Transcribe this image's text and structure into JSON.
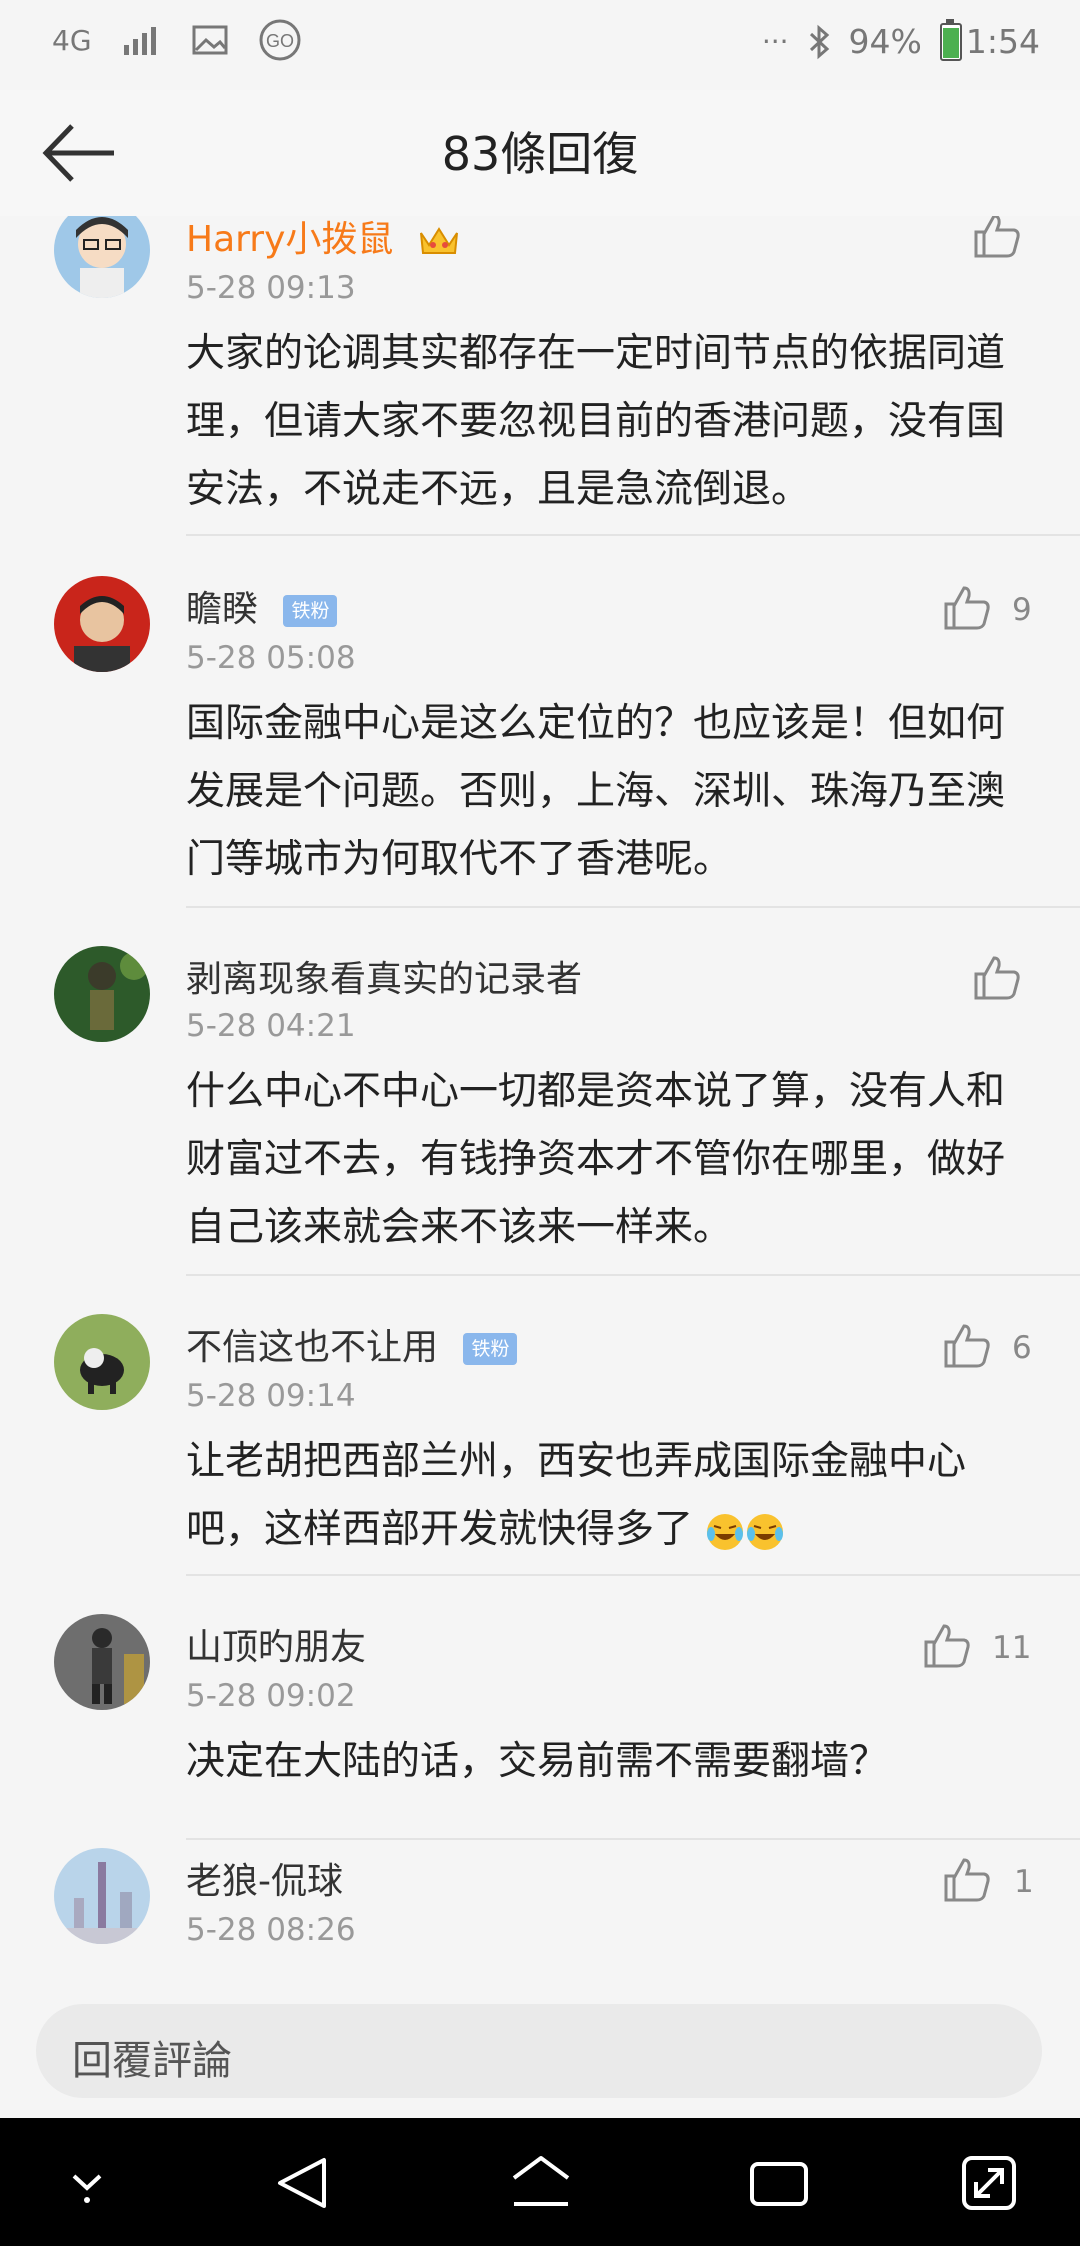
{
  "status_bar": {
    "network": "4G",
    "battery": "94%",
    "time": "1:54",
    "overflow": "···",
    "icons": [
      "network-4g-icon",
      "signal-icon",
      "image-icon",
      "go-icon",
      "bluetooth-icon",
      "battery-icon"
    ]
  },
  "header": {
    "title": "83條回復",
    "back_icon": "arrow-left-icon"
  },
  "comments": [
    {
      "name": "Harry小拨鼠",
      "time": "5-28 09:13",
      "text": "大家的论调其实都存在一定时间节点的依据同道理，但请大家不要忽视目前的香港问题，没有国安法，不说走不远，且是急流倒退。",
      "likes": ""
    },
    {
      "name": "瞻睽",
      "badge": "铁粉",
      "time": "5-28 05:08",
      "text": "国际金融中心是这么定位的？也应该是！但如何发展是个问题。否则，上海、深圳、珠海乃至澳门等城市为何取代不了香港呢。",
      "likes": "9"
    },
    {
      "name": "剥离现象看真实的记录者",
      "time": "5-28 04:21",
      "text": "什么中心不中心一切都是资本说了算，没有人和财富过不去，有钱挣资本才不管你在哪里，做好自己该来就会来不该来一样来。",
      "likes": ""
    },
    {
      "name": "不信这也不让用",
      "badge": "铁粉",
      "time": "5-28 09:14",
      "text": "让老胡把西部兰州，西安也弄成国际金融中心吧，这样西部开发就快得多了",
      "likes": "6"
    },
    {
      "name": "山顶旳朋友",
      "time": "5-28 09:02",
      "text": "决定在大陆的话，交易前需不需要翻墙？",
      "likes": "11"
    },
    {
      "name": "老狼-侃球",
      "time": "5-28 08:26",
      "text": "",
      "likes": "1"
    }
  ],
  "reply_bar": {
    "placeholder": "回覆評論"
  },
  "nav_bar": {
    "icons": [
      "hide-keyboard-icon",
      "back-triangle-icon",
      "home-icon",
      "recents-icon",
      "expand-icon"
    ]
  },
  "colors": {
    "username_highlight": "#f77a19",
    "badge": "#8ab7ec",
    "background": "#f5f5f5"
  }
}
